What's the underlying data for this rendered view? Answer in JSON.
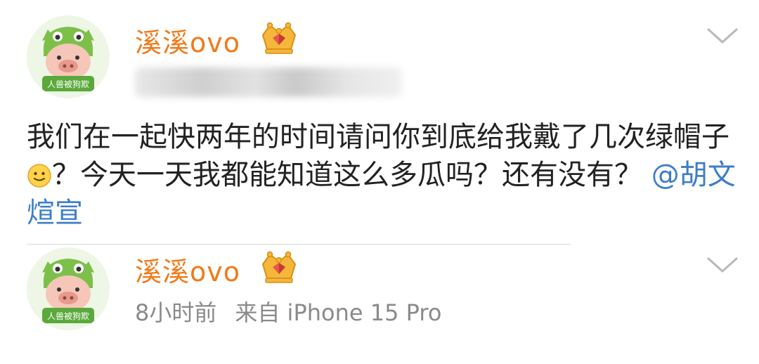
{
  "posts": [
    {
      "avatar_caption": "人兽被狗欺",
      "username": "溪溪ovo",
      "content_text": "我们在一起快两年的时间请问你到底给我戴了几次绿帽子",
      "content_after_emoji": "？今天一天我都能知道这么多瓜吗？还有没有？",
      "mention": "@胡文煊宣"
    },
    {
      "avatar_caption": "人兽被狗欺",
      "username": "溪溪ovo",
      "time": "8小时前",
      "source": "来自 iPhone 15 Pro"
    }
  ],
  "icons": {
    "badge": "crown-badge-icon",
    "more": "chevron-down-icon",
    "emoji": "smiley-emoji-icon"
  },
  "colors": {
    "username": "#f07a1a",
    "mention": "#3d7ec9",
    "meta": "#8a8a8a",
    "avatar_green": "#7cc04a"
  }
}
